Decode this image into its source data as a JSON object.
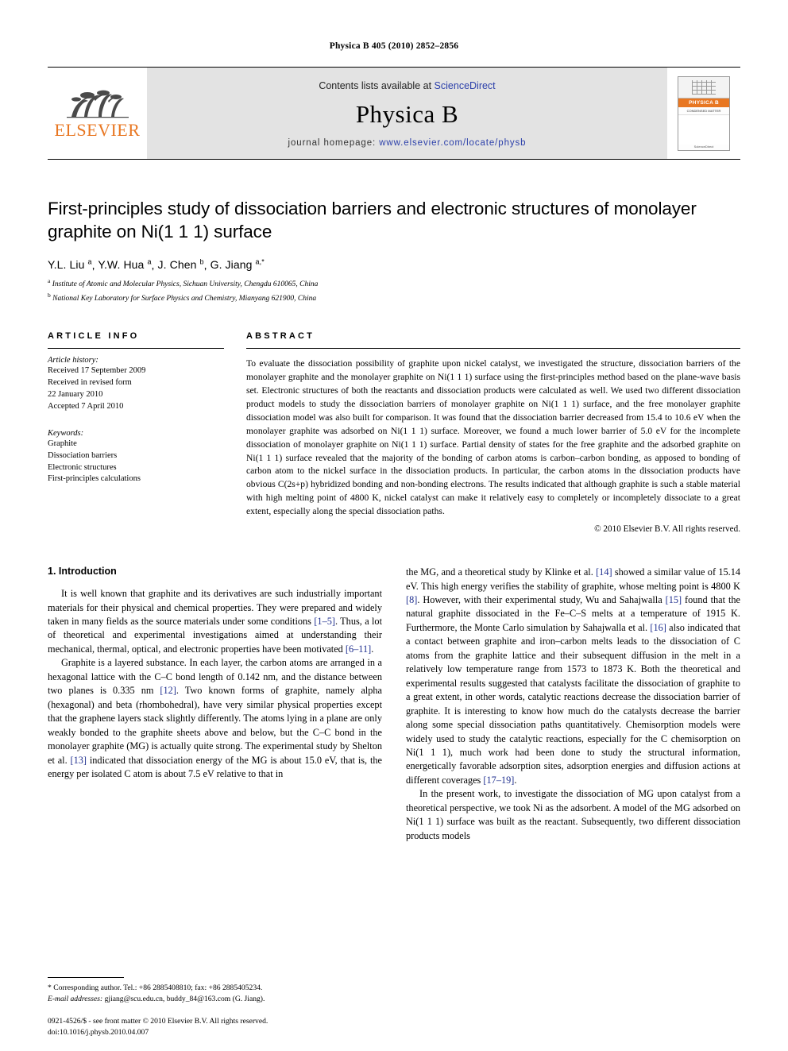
{
  "running_head": "Physica B 405 (2010) 2852–2856",
  "masthead": {
    "contents_prefix": "Contents lists available at",
    "sciencedirect": "ScienceDirect",
    "journal_name": "Physica B",
    "homepage_prefix": "journal homepage:",
    "homepage_url": "www.elsevier.com/locate/physb",
    "publisher_logo": "ELSEVIER",
    "cover_title": "PHYSICA",
    "cover_volume": "B",
    "cover_subtitle": "CONDENSED MATTER",
    "cover_footer": "ScienceDirect",
    "accent_orange": "#E87722",
    "link_blue": "#2b3faa"
  },
  "article": {
    "title": "First-principles study of dissociation barriers and electronic structures of monolayer graphite on Ni(1 1 1) surface",
    "authors": "Y.L. Liu a, Y.W. Hua a, J. Chen b, G. Jiang a,*",
    "affiliations": [
      "Institute of Atomic and Molecular Physics, Sichuan University, Chengdu 610065, China",
      "National Key Laboratory for Surface Physics and Chemistry, Mianyang 621900, China"
    ]
  },
  "info": {
    "heading": "ARTICLE INFO",
    "history_label": "Article history:",
    "history": [
      "Received 17 September 2009",
      "Received in revised form",
      "22 January 2010",
      "Accepted 7 April 2010"
    ],
    "keywords_label": "Keywords:",
    "keywords": [
      "Graphite",
      "Dissociation barriers",
      "Electronic structures",
      "First-principles calculations"
    ]
  },
  "abstract": {
    "heading": "ABSTRACT",
    "text": "To evaluate the dissociation possibility of graphite upon nickel catalyst, we investigated the structure, dissociation barriers of the monolayer graphite and the monolayer graphite on Ni(1 1 1) surface using the first-principles method based on the plane-wave basis set. Electronic structures of both the reactants and dissociation products were calculated as well. We used two different dissociation product models to study the dissociation barriers of monolayer graphite on Ni(1 1 1) surface, and the free monolayer graphite dissociation model was also built for comparison. It was found that the dissociation barrier decreased from 15.4 to 10.6 eV when the monolayer graphite was adsorbed on Ni(1 1 1) surface. Moreover, we found a much lower barrier of 5.0 eV for the incomplete dissociation of monolayer graphite on Ni(1 1 1) surface. Partial density of states for the free graphite and the adsorbed graphite on Ni(1 1 1) surface revealed that the majority of the bonding of carbon atoms is carbon–carbon bonding, as apposed to bonding of carbon atom to the nickel surface in the dissociation products. In particular, the carbon atoms in the dissociation products have obvious C(2s+p) hybridized bonding and non-bonding electrons. The results indicated that although graphite is such a stable material with high melting point of 4800 K, nickel catalyst can make it relatively easy to completely or incompletely dissociate to a great extent, especially along the special dissociation paths.",
    "copyright": "© 2010 Elsevier B.V. All rights reserved."
  },
  "introduction": {
    "heading": "1. Introduction",
    "left_paragraphs": [
      "It is well known that graphite and its derivatives are such industrially important materials for their physical and chemical properties. They were prepared and widely taken in many fields as the source materials under some conditions [1–5]. Thus, a lot of theoretical and experimental investigations aimed at understanding their mechanical, thermal, optical, and electronic properties have been motivated [6–11].",
      "Graphite is a layered substance. In each layer, the carbon atoms are arranged in a hexagonal lattice with the C–C bond length of 0.142 nm, and the distance between two planes is 0.335 nm [12]. Two known forms of graphite, namely alpha (hexagonal) and beta (rhombohedral), have very similar physical properties except that the graphene layers stack slightly differently. The atoms lying in a plane are only weakly bonded to the graphite sheets above and below, but the C–C bond in the monolayer graphite (MG) is actually quite strong. The experimental study by Shelton et al. [13] indicated that dissociation energy of the MG is about 15.0 eV, that is, the energy per isolated C atom is about 7.5 eV relative to that in"
    ],
    "right_paragraphs": [
      "the MG, and a theoretical study by Klinke et al. [14] showed a similar value of 15.14 eV. This high energy verifies the stability of graphite, whose melting point is 4800 K [8]. However, with their experimental study, Wu and Sahajwalla [15] found that the natural graphite dissociated in the Fe–C–S melts at a temperature of 1915 K. Furthermore, the Monte Carlo simulation by Sahajwalla et al. [16] also indicated that a contact between graphite and iron–carbon melts leads to the dissociation of C atoms from the graphite lattice and their subsequent diffusion in the melt in a relatively low temperature range from 1573 to 1873 K. Both the theoretical and experimental results suggested that catalysts facilitate the dissociation of graphite to a great extent, in other words, catalytic reactions decrease the dissociation barrier of graphite. It is interesting to know how much do the catalysts decrease the barrier along some special dissociation paths quantitatively. Chemisorption models were widely used to study the catalytic reactions, especially for the C chemisorption on Ni(1 1 1), much work had been done to study the structural information, energetically favorable adsorption sites, adsorption energies and diffusion actions at different coverages [17–19].",
      "In the present work, to investigate the dissociation of MG upon catalyst from a theoretical perspective, we took Ni as the adsorbent. A model of the MG adsorbed on Ni(1 1 1) surface was built as the reactant. Subsequently, two different dissociation products models"
    ]
  },
  "footnote": {
    "corresponding": "* Corresponding author. Tel.: +86 2885408810; fax: +86 2885405234.",
    "email_label": "E-mail addresses:",
    "emails": "gjiang@scu.edu.cn, buddy_84@163.com (G. Jiang)."
  },
  "imprint": {
    "line1": "0921-4526/$ - see front matter © 2010 Elsevier B.V. All rights reserved.",
    "line2": "doi:10.1016/j.physb.2010.04.007"
  }
}
